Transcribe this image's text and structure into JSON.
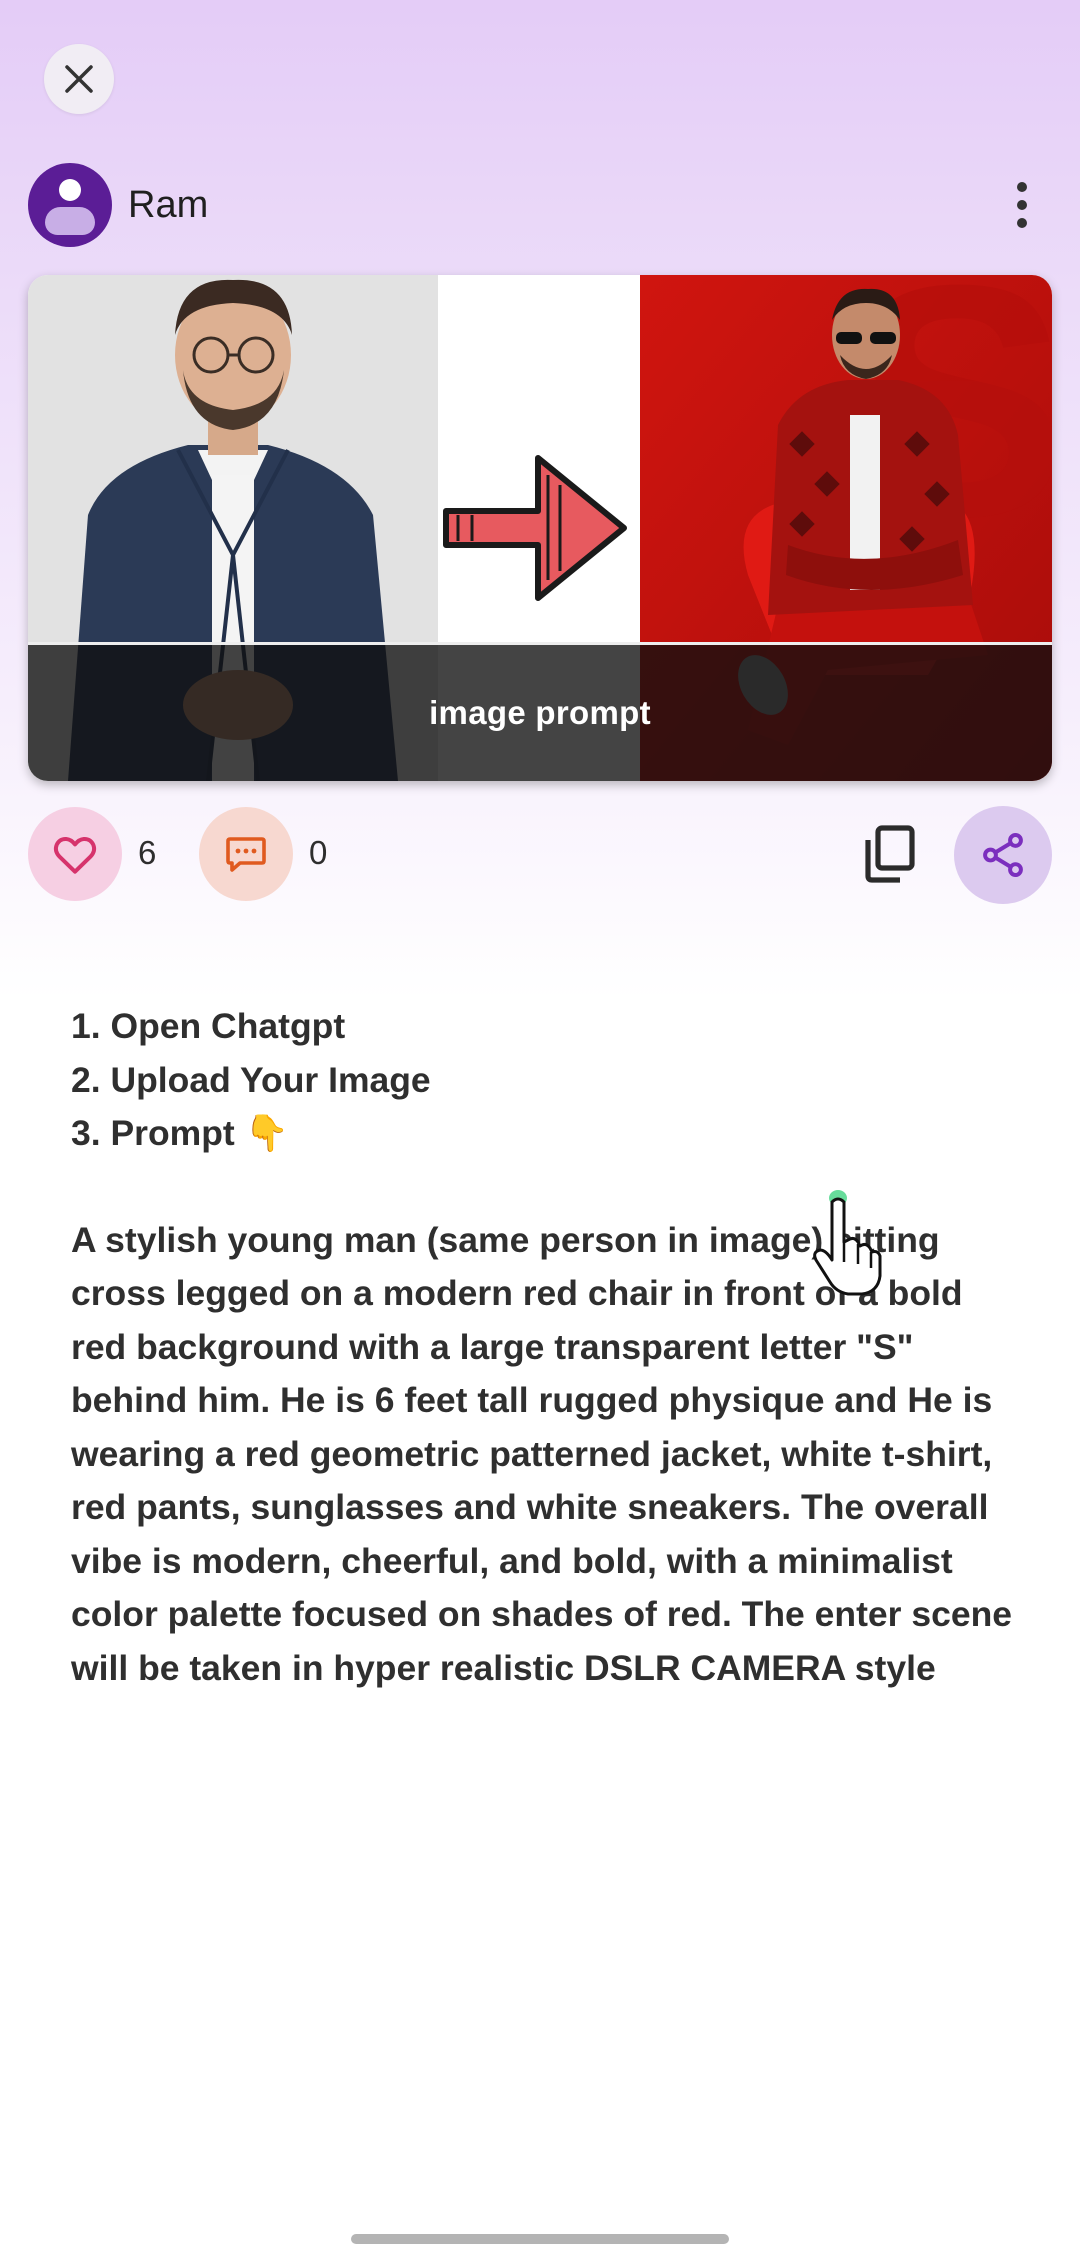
{
  "author": {
    "name": "Ram"
  },
  "post": {
    "image_caption": "image prompt",
    "like_count": "6",
    "comment_count": "0"
  },
  "steps": [
    "1. Open Chatgpt",
    "2. Upload Your Image",
    "3. Prompt 👇"
  ],
  "prompt_text": "A stylish young man (same person in image) sitting cross legged on a modern red chair in front of a bold red background with a large transparent letter \"S\" behind him. He is 6 feet tall rugged physique and He is wearing a red geometric patterned jacket, white t-shirt, red pants, sunglasses and white sneakers. The overall vibe is modern, cheerful, and bold, with a minimalist color palette focused on shades of red. The enter scene will be taken in hyper realistic DSLR CAMERA style",
  "icons": {
    "close": "close-icon",
    "avatar": "person-icon",
    "more": "more-vert-icon",
    "like": "heart-icon",
    "comment": "chat-bubble-icon",
    "copy": "copy-icon",
    "share": "share-icon",
    "arrow": "arrow-right-icon"
  },
  "colors": {
    "accent": "#7b2fbe",
    "like_bg": "#f6cfe3",
    "like_icon": "#d6336c",
    "comment_bg": "#f7d8d0",
    "comment_icon": "#e05a1f",
    "share_bg": "#dccaef",
    "hero_red": "#c8120f"
  }
}
